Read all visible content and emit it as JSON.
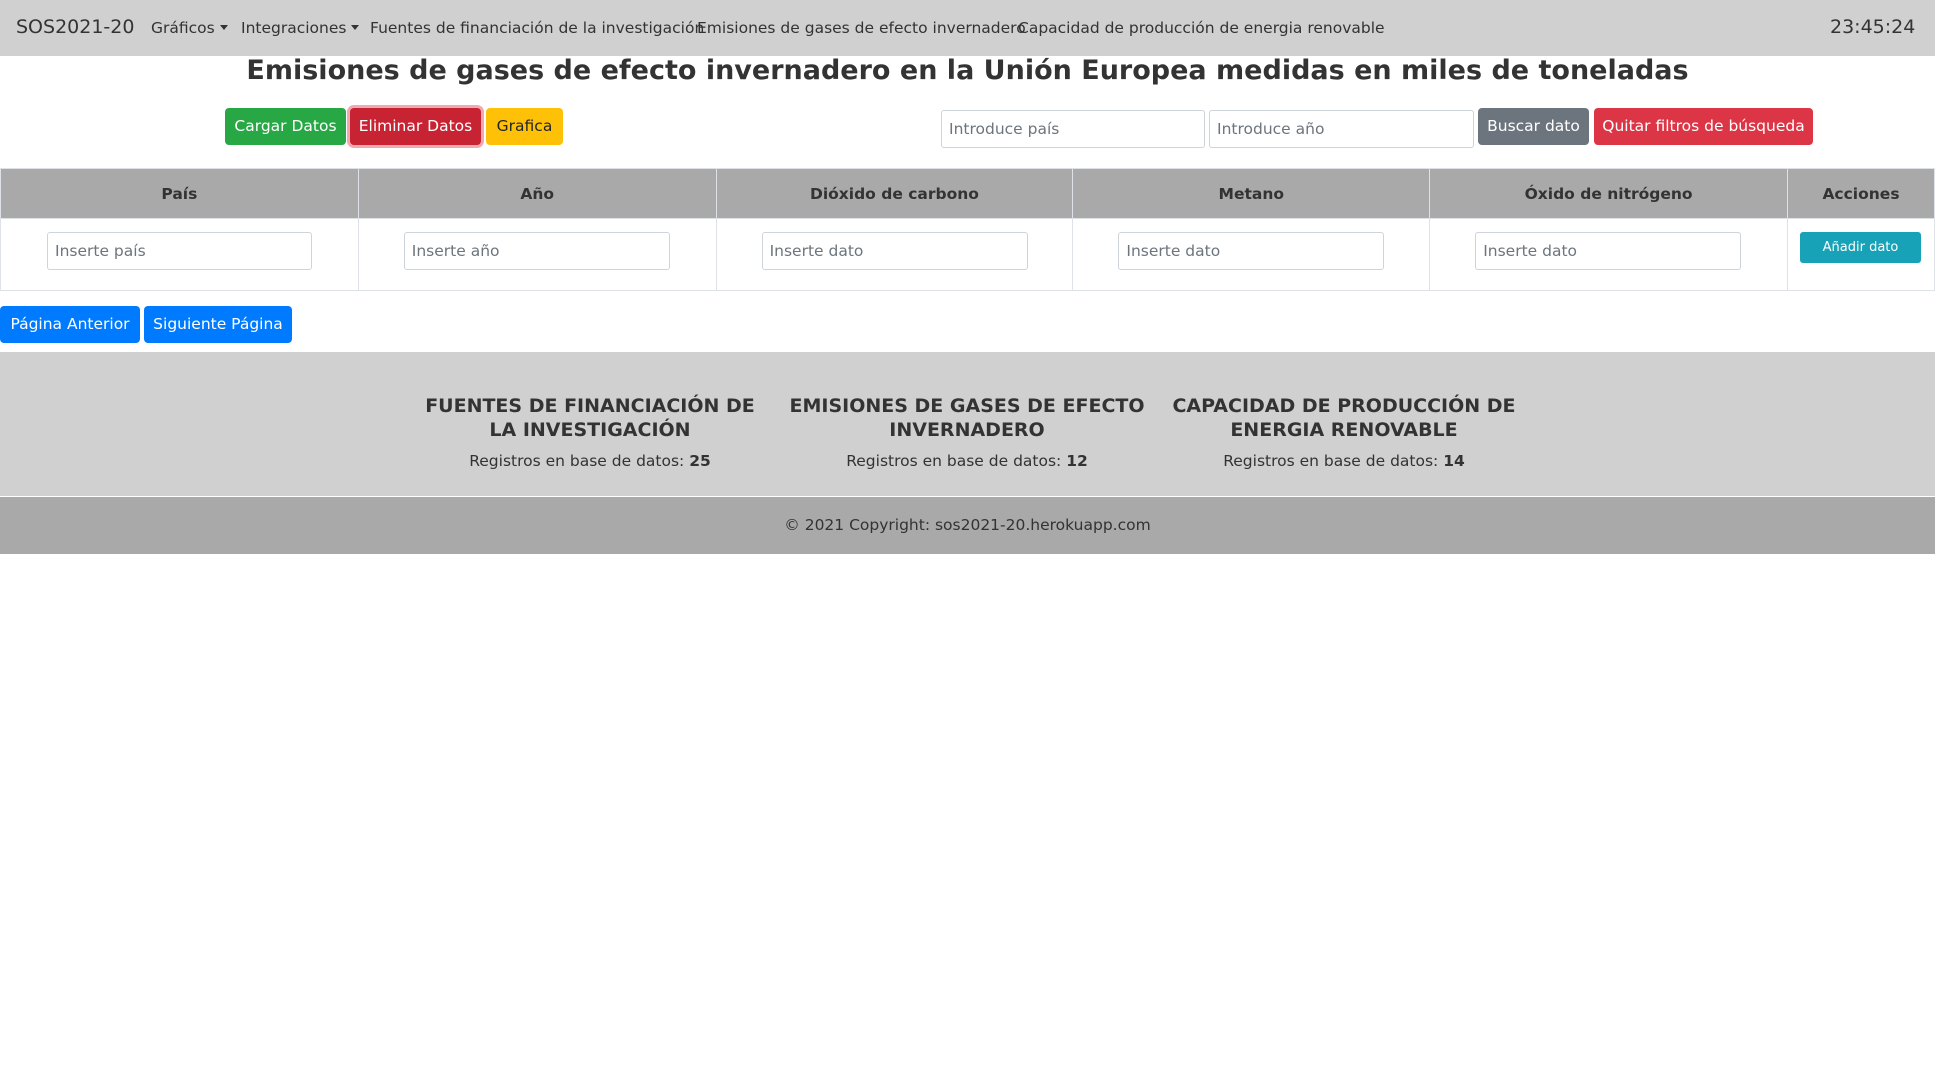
{
  "navbar": {
    "brand": "SOS2021-20",
    "items": [
      {
        "label": "Gráficos",
        "dropdown": true
      },
      {
        "label": "Integraciones",
        "dropdown": true
      },
      {
        "label": "Fuentes de financiación de la investigación",
        "dropdown": false
      },
      {
        "label": "Emisiones de gases de efecto invernadero",
        "dropdown": false
      },
      {
        "label": "Capacidad de producción de energia renovable",
        "dropdown": false
      }
    ],
    "clock": "23:45:24"
  },
  "page_title": "Emisiones de gases de efecto invernadero en la Unión Europea medidas en miles de toneladas",
  "toolbar": {
    "load_label": "Cargar Datos",
    "delete_label": "Eliminar Datos",
    "chart_label": "Grafica",
    "search_country_placeholder": "Introduce país",
    "search_year_placeholder": "Introduce año",
    "search_label": "Buscar dato",
    "clear_filters_label": "Quitar filtros de búsqueda"
  },
  "table": {
    "headers": [
      "País",
      "Año",
      "Dióxido de carbono",
      "Metano",
      "Óxido de nitrógeno",
      "Acciones"
    ],
    "input_placeholders": [
      "Inserte país",
      "Inserte año",
      "Inserte dato",
      "Inserte dato",
      "Inserte dato"
    ],
    "add_label": "Añadir dato"
  },
  "pagination": {
    "prev_label": "Página Anterior",
    "next_label": "Siguiente Página"
  },
  "stats": [
    {
      "title": "FUENTES DE FINANCIACIÓN DE LA INVESTIGACIÓN",
      "prefix": "Registros en base de datos:",
      "count": "25"
    },
    {
      "title": "EMISIONES DE GASES DE EFECTO INVERNADERO",
      "prefix": "Registros en base de datos:",
      "count": "12"
    },
    {
      "title": "CAPACIDAD DE PRODUCCIÓN DE ENERGIA RENOVABLE",
      "prefix": "Registros en base de datos:",
      "count": "14"
    }
  ],
  "copyright": "© 2021 Copyright: sos2021-20.herokuapp.com",
  "colors": {
    "navbar_bg": "#d0d0d0",
    "success": "#28a745",
    "danger": "#dc3545",
    "warning": "#ffc107",
    "secondary": "#6c757d",
    "primary": "#007bff",
    "info": "#17a2b8"
  }
}
